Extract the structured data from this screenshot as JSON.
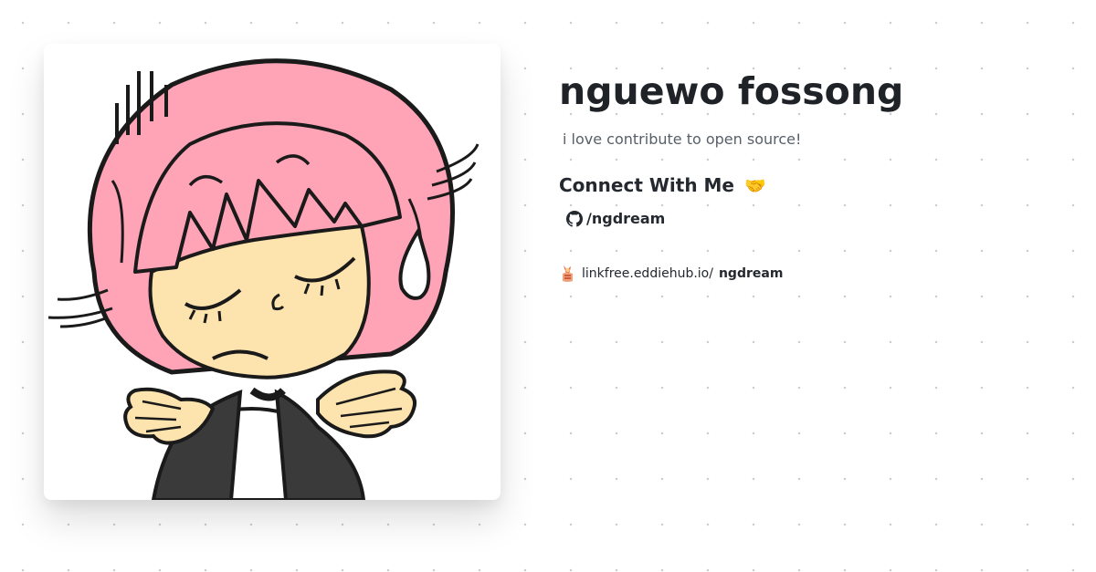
{
  "profile": {
    "name": "nguewo fossong",
    "bio": "i love contribute to open source!",
    "avatar_icon": "shrugging-girl-avatar"
  },
  "connect": {
    "heading": "Connect With Me",
    "heading_emoji": "🤝"
  },
  "socials": [
    {
      "icon": "github-icon",
      "label": "/ngdream"
    }
  ],
  "footer": {
    "icon": "linkfree-logo-icon",
    "domain": "linkfree.eddiehub.io/",
    "username": "ngdream"
  },
  "colors": {
    "text_primary": "#1f2328",
    "text_secondary": "#57606a",
    "hair_pink": "#ffa3b6",
    "skin": "#fde3ad",
    "background_dots": "#c9ccd1"
  }
}
